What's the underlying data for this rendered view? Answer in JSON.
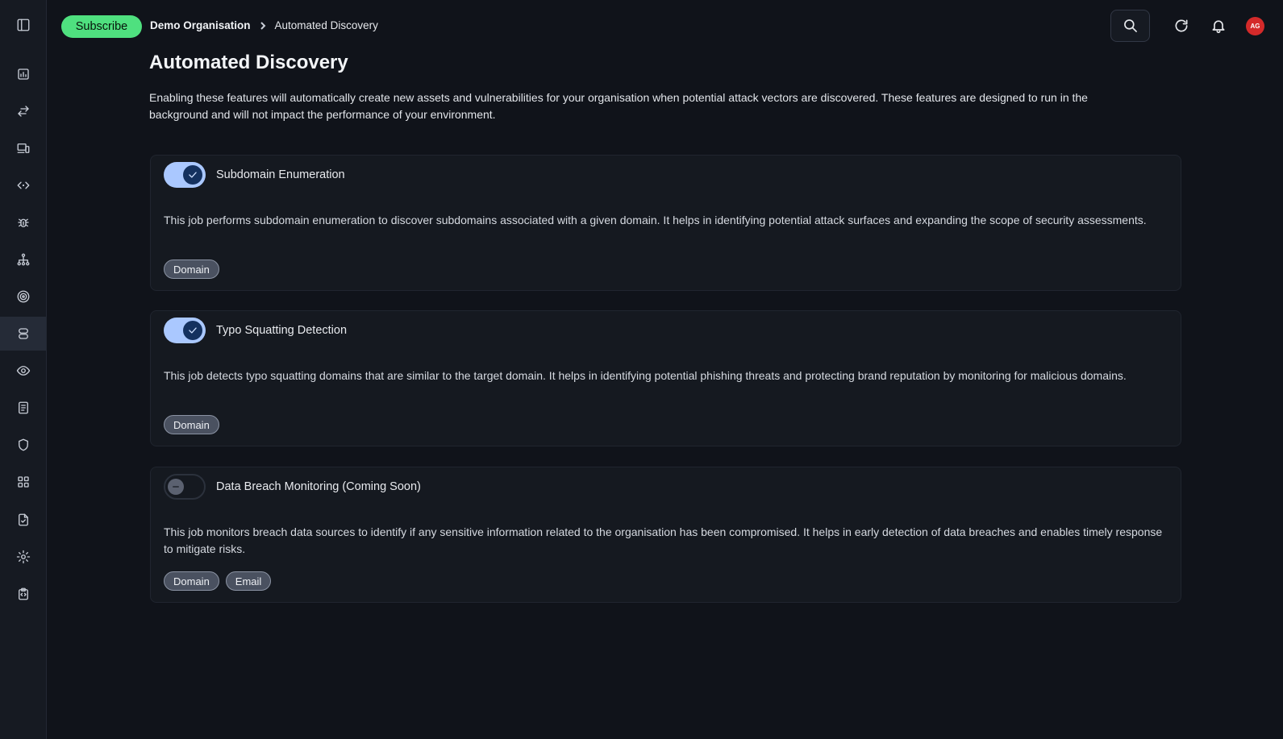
{
  "header": {
    "subscribe_label": "Subscribe",
    "breadcrumb": {
      "org": "Demo Organisation",
      "current": "Automated Discovery"
    },
    "avatar_initials": "AG"
  },
  "sidebar": {
    "items": [
      {
        "icon": "dashboard-chart-icon"
      },
      {
        "icon": "transfer-arrows-icon"
      },
      {
        "icon": "devices-icon"
      },
      {
        "icon": "code-icon"
      },
      {
        "icon": "bug-icon"
      },
      {
        "icon": "hierarchy-icon"
      },
      {
        "icon": "target-icon"
      },
      {
        "icon": "database-icon",
        "active": true
      },
      {
        "icon": "eye-icon"
      },
      {
        "icon": "document-icon"
      },
      {
        "icon": "shield-icon"
      },
      {
        "icon": "apps-grid-icon"
      },
      {
        "icon": "file-check-icon"
      },
      {
        "icon": "settings-gear-icon"
      },
      {
        "icon": "code-clipboard-icon"
      }
    ]
  },
  "main": {
    "title": "Automated Discovery",
    "description": "Enabling these features will automatically create new assets and vulnerabilities for your organisation when potential attack vectors are discovered. These features are designed to run in the background and will not impact the performance of your environment.",
    "jobs": [
      {
        "title": "Subdomain Enumeration",
        "enabled": true,
        "description": "This job performs subdomain enumeration to discover subdomains associated with a given domain. It helps in identifying potential attack surfaces and expanding the scope of security assessments.",
        "tags": [
          "Domain"
        ]
      },
      {
        "title": "Typo Squatting Detection",
        "enabled": true,
        "description": "This job detects typo squatting domains that are similar to the target domain. It helps in identifying potential phishing threats and protecting brand reputation by monitoring for malicious domains.",
        "tags": [
          "Domain"
        ]
      },
      {
        "title": "Data Breach Monitoring (Coming Soon)",
        "enabled": false,
        "description": "This job monitors breach data sources to identify if any sensitive information related to the organisation has been compromised. It helps in early detection of data breaches and enables timely response to mitigate risks.",
        "tags": [
          "Domain",
          "Email"
        ]
      }
    ]
  },
  "colors": {
    "background": "#10131a",
    "subscribe_accent": "#4fe07f",
    "toggle_on": "#aac8ff",
    "avatar": "#d42a2a"
  }
}
